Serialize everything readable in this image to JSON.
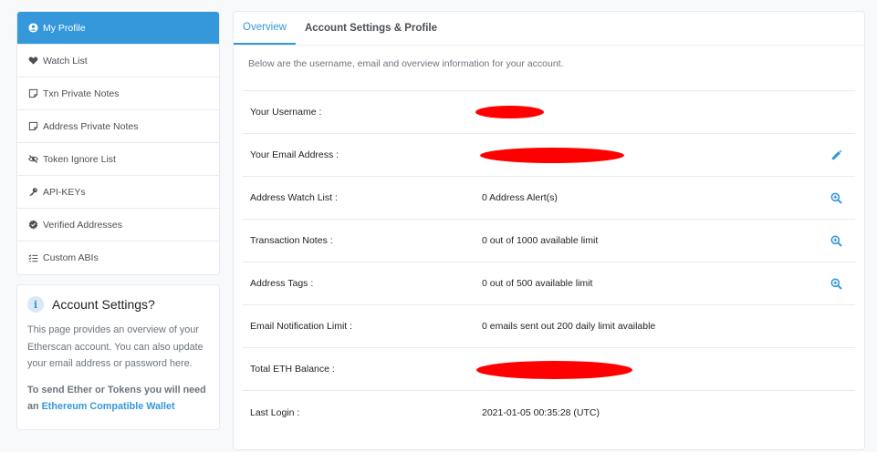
{
  "sidebar": {
    "items": [
      {
        "label": "My Profile",
        "icon": "user-circle-icon"
      },
      {
        "label": "Watch List",
        "icon": "heart-icon"
      },
      {
        "label": "Txn Private Notes",
        "icon": "note-icon"
      },
      {
        "label": "Address Private Notes",
        "icon": "note-icon"
      },
      {
        "label": "Token Ignore List",
        "icon": "eye-slash-icon"
      },
      {
        "label": "API-KEYs",
        "icon": "key-icon"
      },
      {
        "label": "Verified Addresses",
        "icon": "check-badge-icon"
      },
      {
        "label": "Custom ABIs",
        "icon": "list-check-icon"
      }
    ]
  },
  "info": {
    "title": "Account Settings?",
    "body": "This page provides an overview of your Etherscan account. You can also update your email address or password here.",
    "cta": "To send Ether or Tokens you will need an",
    "link": "Ethereum Compatible Wallet"
  },
  "tabs": [
    "Overview",
    "Account Settings & Profile"
  ],
  "intro": "Below are the username, email and overview information for your account.",
  "rows": [
    {
      "label": "Your Username :",
      "value": ""
    },
    {
      "label": "Your Email Address :",
      "value": ""
    },
    {
      "label": "Address Watch List :",
      "value": "0 Address Alert(s)"
    },
    {
      "label": "Transaction Notes :",
      "value": "0 out of 1000 available limit"
    },
    {
      "label": "Address Tags :",
      "value": "0 out of 500 available limit"
    },
    {
      "label": "Email Notification Limit :",
      "value": "0 emails sent out 200 daily limit available"
    },
    {
      "label": "Total ETH Balance :",
      "value": ""
    },
    {
      "label": "Last Login :",
      "value": "2021-01-05 00:35:28 (UTC)"
    }
  ],
  "colors": {
    "accent": "#3498db",
    "redaction": "#ff0000"
  }
}
